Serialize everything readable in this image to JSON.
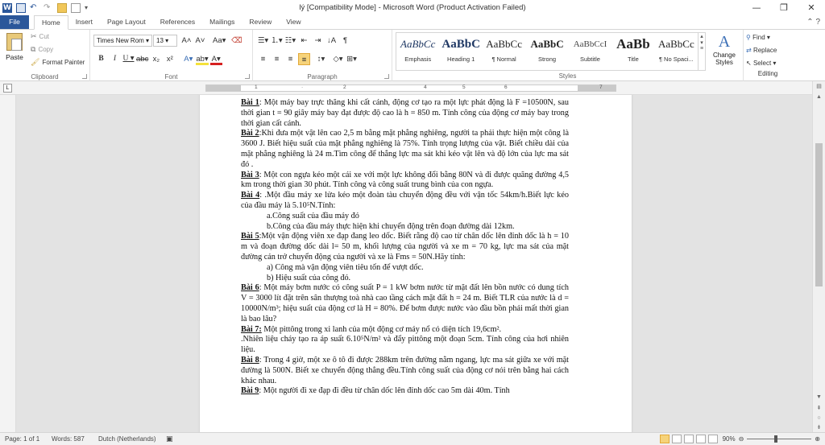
{
  "window": {
    "title": "lý [Compatibility Mode]  -  Microsoft Word (Product Activation Failed)",
    "controls": [
      "—",
      "❐",
      "✕"
    ]
  },
  "tabs": [
    "File",
    "Home",
    "Insert",
    "Page Layout",
    "References",
    "Mailings",
    "Review",
    "View"
  ],
  "active_tab": "Home",
  "clipboard": {
    "paste": "Paste",
    "cut": "Cut",
    "copy": "Copy",
    "format_painter": "Format Painter",
    "label": "Clipboard"
  },
  "font": {
    "name": "Times New Rom",
    "size": "13",
    "label": "Font"
  },
  "paragraph": {
    "label": "Paragraph"
  },
  "styles": {
    "label": "Styles",
    "items": [
      {
        "sample": "AaBbCc",
        "name": "Emphasis"
      },
      {
        "sample": "AaBbC",
        "name": "Heading 1"
      },
      {
        "sample": "AaBbCc",
        "name": "¶ Normal"
      },
      {
        "sample": "AaBbC",
        "name": "Strong"
      },
      {
        "sample": "AaBbCcI",
        "name": "Subtitle"
      },
      {
        "sample": "AaBb",
        "name": "Title"
      },
      {
        "sample": "AaBbCc",
        "name": "¶ No Spaci..."
      }
    ],
    "change_styles": "Change Styles"
  },
  "editing": {
    "label": "Editing",
    "find": "Find",
    "replace": "Replace",
    "select": "Select"
  },
  "document": {
    "p1_title": "Bài 1",
    "p1": ": Một máy bay trực thăng khi cất cánh, động cơ tạo ra một lực phát động là F =10500N, sau thời gian t = 90 giây máy bay đạt được độ cao là h = 850 m. Tính công của động cơ máy bay trong thời gian cất cánh.",
    "p2_title": "Bài 2",
    "p2": ":Khi đưa một vật lên cao 2,5 m bằng mặt phẳng nghiêng, người ta phải thực hiện một công là 3600 J. Biết hiệu suất của mặt phẳng nghiêng là 75%. Tính trọng lượng của vật. Biết chiều dài của mặt phẳng nghiêng  là 24 m.Tìm công để thắng lực ma sát khi kéo vật lên và độ lớn của lực ma sát đó .",
    "p3_title": "Bài 3",
    "p3": ": Một con ngựa kéo một cái xe với một lực không đổi bằng 80N và đi được quãng đường 4,5 km trong thời gian 30 phút. Tính công và công suất trung bình của con ngựa.",
    "p4_title": "Bài 4",
    "p4": ": .Một đầu máy xe lửa kéo một đoàn tàu chuyển động đều với vận tốc 54km/h.Biết lực kéo của đầu máy là 5.10⁵N.Tính:",
    "p4a": "a.Công suất của đầu máy đó",
    "p4b": "b.Công của đầu máy thực hiện khi chuyển động trên đoạn đường dài 12km.",
    "p5_title": "Bài 5",
    "p5": ":Một vận động viên xe đạp đang leo dốc. Biết rằng độ cao từ chân dốc lên đỉnh dốc là h = 10 m và đoạn đường dốc dài l= 50 m, khối lượng của người và xe m = 70 kg, lực ma sát của mặt đường cản trở chuyển động của người và xe là Fms = 50N.Hãy tính:",
    "p5a": "a)  Công mà vận động viên tiêu tốn để vượt dốc.",
    "p5b": "b)  Hiệu suất của công đó.",
    "p6_title": "Bài 6",
    "p6": ": Một máy bơm nước có công suất P = 1 kW bơm nước từ mặt đất lên bồn nước có dung tích V = 3000 lít đặt trên sân thượng toà nhà cao tầng cách mặt đất h = 24 m. Biết TLR của nước là d = 10000N/m³; hiệu suất của động cơ là H = 80%. Để bơm được nước vào đầu bồn phải mất thời gian là bao lâu?",
    "p7_title": "Bài 7:",
    "p7": "  Một pittông trong xi lanh của một động cơ máy nổ có diện tích 19,6cm².",
    "p7b": ".Nhiên liệu cháy tạo ra áp suất 6.10⁵N/m² và đẩy pittông một đoạn 5cm. Tính công của hơi nhiên liệu.",
    "p8_title": "Bài 8",
    "p8": ": Trong 4 giờ, một xe ô tô đi được 288km trên đường nằm ngang, lực ma sát giữa xe với mặt đường là 500N. Biết xe chuyển động thẳng đều.Tính công suất của động cơ nói trên bằng hai cách khác nhau.",
    "p9_title": "Bài 9",
    "p9": ": Một người đi xe đạp đi đều từ chân dốc lên đỉnh dốc cao 5m dài 40m. Tính"
  },
  "status": {
    "page": "Page: 1 of 1",
    "words": "Words: 587",
    "language": "Dutch (Netherlands)",
    "zoom": "90%"
  }
}
